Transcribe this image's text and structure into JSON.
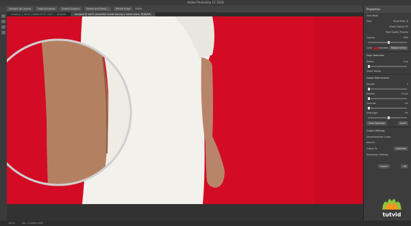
{
  "window": {
    "title": "Adobe Photoshop CC 2018"
  },
  "options_bar": {
    "items": [
      "Sample All Layers",
      "Auto-Enhance",
      "Select Subject",
      "Select and Mask...",
      "Refine Edge"
    ],
    "zoom": "100%"
  },
  "tabs": [
    {
      "label": "rosebud_1_6b00_24b8fb.tif @ 100% ... (RGB/8)",
      "active": false
    },
    {
      "label": "amazed @ 100% (beautiful model posing in white dress, RGB/8#)",
      "active": true
    }
  ],
  "properties": {
    "title": "Properties",
    "view_mode_label": "View Mode",
    "view_label": "View",
    "show_edge": "Show Edge (J)",
    "show_original": "Show Original (P)",
    "hq_preview": "High Quality Preview",
    "opacity_label": "Opacity",
    "opacity_value": "50%",
    "color_label": "Color",
    "indicates_label": "Indicates",
    "indicates_value": "Masked Areas",
    "edge_detection": "Edge Detection",
    "radius_label": "Radius",
    "radius_value": "0 px",
    "smart_radius": "Smart Radius",
    "global_refinements": "Global Refinements",
    "smooth_label": "Smooth",
    "smooth_value": "0",
    "feather_label": "Feather",
    "feather_value": "0.0 px",
    "contrast_label": "Contrast",
    "contrast_value": "0%",
    "shift_edge_label": "Shift Edge",
    "shift_edge_value": "0%",
    "clear_selection": "Clear Selection",
    "invert": "Invert",
    "output_settings": "Output Settings",
    "decontaminate": "Decontaminate Colors",
    "amount_label": "Amount",
    "output_to_label": "Output To",
    "output_to_value": "Selection",
    "remember": "Remember Settings",
    "cancel": "Cancel",
    "ok": "OK"
  },
  "status": {
    "zoom": "100%",
    "doc": "Doc: 5.49M/5.49M"
  },
  "logo": {
    "text": "tutvid"
  },
  "colors": {
    "background": "#d40b24",
    "dress": "#f3f1ec",
    "skin": "#b9856a"
  }
}
